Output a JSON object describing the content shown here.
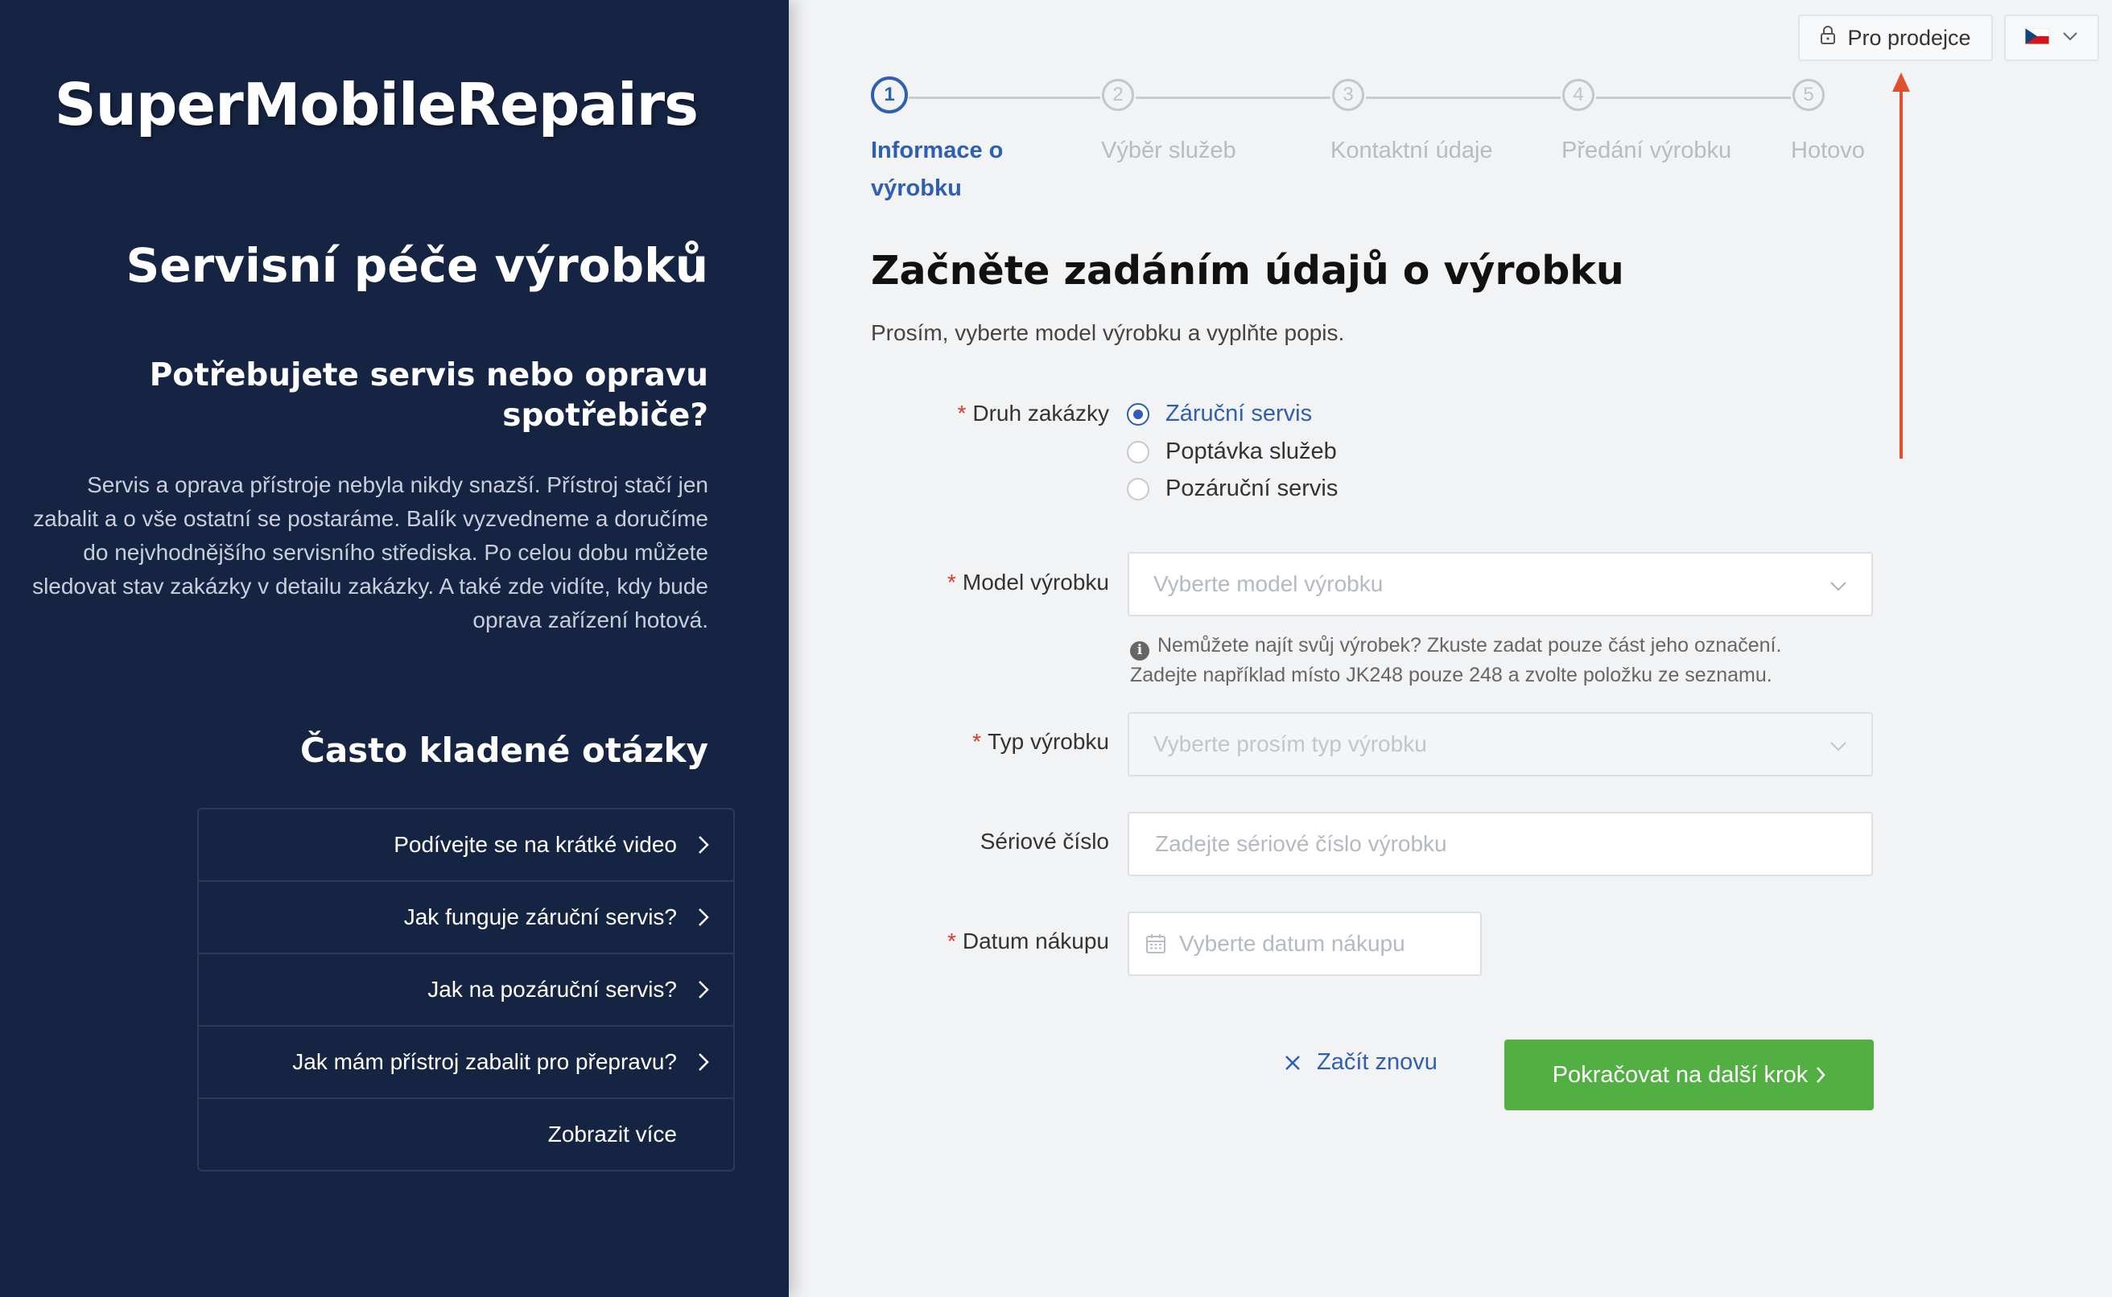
{
  "sidebar": {
    "brand": "SuperMobileRepairs",
    "title": "Servisní péče výrobků",
    "subtitle": "Potřebujete servis nebo opravu spotřebiče?",
    "description": "Servis a oprava přístroje nebyla nikdy snazší. Přístroj stačí jen zabalit a o vše ostatní se postaráme. Balík vyzvedneme a doručíme do nejvhodnějšího servisního střediska. Po celou dobu můžete sledovat stav zakázky v detailu zakázky. A také zde vidíte, kdy bude oprava zařízení hotová.",
    "faq_title": "Často kladené otázky",
    "faq": [
      {
        "label": "Podívejte se na krátké video"
      },
      {
        "label": "Jak funguje záruční servis?"
      },
      {
        "label": "Jak na pozáruční servis?"
      },
      {
        "label": "Jak mám přístroj zabalit pro přepravu?"
      },
      {
        "label": "Zobrazit více"
      }
    ]
  },
  "header": {
    "dealer_button": "Pro prodejce",
    "language_flag": "cz-flag"
  },
  "stepper": {
    "active": 1,
    "steps": [
      {
        "number": "1",
        "label": "Informace o výrobku"
      },
      {
        "number": "2",
        "label": "Výběr služeb"
      },
      {
        "number": "3",
        "label": "Kontaktní údaje"
      },
      {
        "number": "4",
        "label": "Předání výrobku"
      },
      {
        "number": "5",
        "label": "Hotovo"
      }
    ]
  },
  "form": {
    "title": "Začněte zadáním údajů o výrobku",
    "subtitle": "Prosím, vyberte model výrobku a vyplňte popis.",
    "required_mark": "*",
    "order_type": {
      "label": "Druh zakázky",
      "options": [
        "Záruční servis",
        "Poptávka služeb",
        "Pozáruční servis"
      ],
      "selected": "Záruční servis"
    },
    "model": {
      "label": "Model výrobku",
      "placeholder": "Vyberte model výrobku",
      "hint_line1": "Nemůžete najít svůj výrobek? Zkuste zadat pouze část jeho označení.",
      "hint_line2": "Zadejte například místo JK248 pouze 248 a zvolte položku ze seznamu."
    },
    "product_type": {
      "label": "Typ výrobku",
      "placeholder": "Vyberte prosím typ výrobku"
    },
    "serial": {
      "label": "Sériové číslo",
      "placeholder": "Zadejte sériové číslo výrobku"
    },
    "purchase_date": {
      "label": "Datum nákupu",
      "placeholder": "Vyberte datum nákupu"
    },
    "reset_label": "Začít znovu",
    "next_label": "Pokračovat na další krok"
  },
  "colors": {
    "sidebar_bg": "#162443",
    "accent": "#2f5fb3",
    "primary_button": "#52b043",
    "required": "#e0352b",
    "annotation_arrow": "#e0502c"
  }
}
